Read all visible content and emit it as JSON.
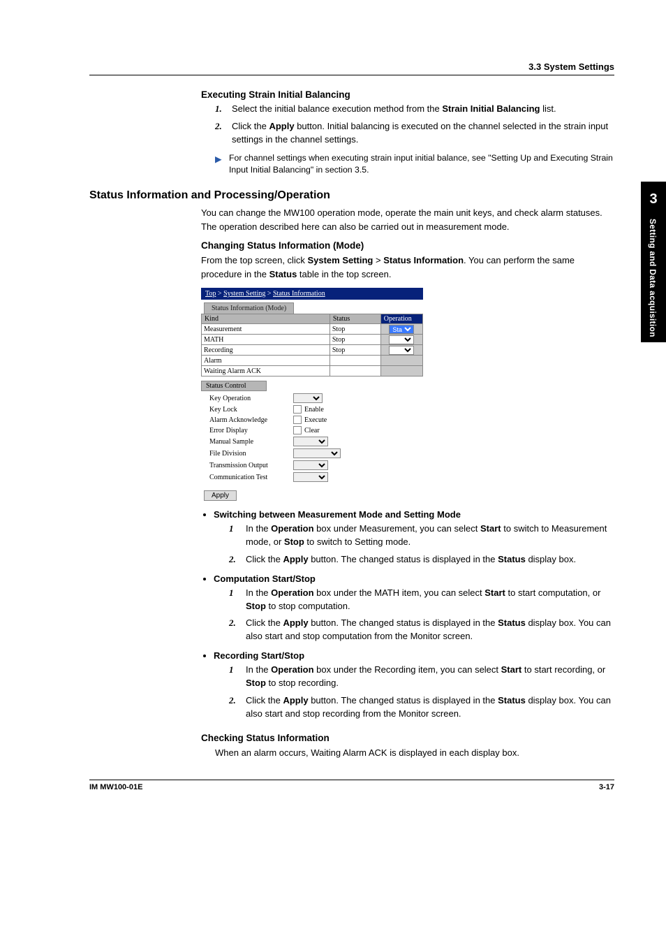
{
  "header": {
    "section": "3.3  System Settings"
  },
  "sidebar": {
    "chapter": "3",
    "title": "Setting and Data acquisition"
  },
  "strain": {
    "heading": "Executing Strain Initial Balancing",
    "steps": [
      {
        "n": "1.",
        "pre": "Select the initial balance execution method from the ",
        "bold": "Strain Initial Balancing",
        "post": " list."
      },
      {
        "n": "2.",
        "pre": "Click the ",
        "bold": "Apply",
        "post": " button. Initial balancing is executed on the channel selected in the strain input settings in the channel settings."
      }
    ],
    "note": "For channel settings when executing strain input initial balance, see \"Setting Up and Executing Strain Input Initial Balancing\" in section 3.5."
  },
  "status_section": {
    "heading": "Status Information and Processing/Operation",
    "intro": "You can change the MW100 operation mode, operate the main unit keys, and check alarm statuses. The operation described here can also be carried out in measurement mode.",
    "changing": {
      "heading": "Changing Status Information (Mode)",
      "p1a": "From the top screen, click ",
      "b1": "System Setting",
      "sep": " > ",
      "b2": "Status Information",
      "p1b": ". You can perform the same procedure in the ",
      "b3": "Status",
      "p1c": " table in the top screen."
    },
    "ui": {
      "breadcrumb": {
        "top": "Top",
        "s1": "System Setting",
        "s2": "Status Information"
      },
      "tab": "Status Information (Mode)",
      "cols": {
        "kind": "Kind",
        "status": "Status",
        "operation": "Operation"
      },
      "rows": [
        {
          "kind": "Measurement",
          "status": "Stop",
          "op": "Start"
        },
        {
          "kind": "MATH",
          "status": "Stop",
          "op": ""
        },
        {
          "kind": "Recording",
          "status": "Stop",
          "op": ""
        },
        {
          "kind": "Alarm",
          "status": "",
          "op": null
        },
        {
          "kind": "Waiting Alarm ACK",
          "status": "",
          "op": null
        }
      ],
      "control_header": "Status Control",
      "control": {
        "key_op": "Key Operation",
        "key_lock": "Key Lock",
        "key_lock_cb": "Enable",
        "alarm_ack": "Alarm Acknowledge",
        "alarm_ack_cb": "Execute",
        "err_disp": "Error Display",
        "err_disp_cb": "Clear",
        "manual": "Manual Sample",
        "file_div": "File Division",
        "trans": "Transmission Output",
        "comm": "Communication Test"
      },
      "apply": "Apply"
    },
    "bullets": {
      "b1": {
        "title": "Switching between Measurement Mode and Setting Mode",
        "s1": {
          "n": "1",
          "a": "In the ",
          "b1": "Operation",
          "b": " box under Measurement, you can select ",
          "b2": "Start",
          "c": " to switch to Measurement mode, or ",
          "b3": "Stop",
          "d": " to switch to Setting mode."
        },
        "s2": {
          "n": "2.",
          "a": "Click the ",
          "b1": "Apply",
          "b": " button. The changed status is displayed in the ",
          "b2": "Status",
          "c": " display box."
        }
      },
      "b2": {
        "title": "Computation Start/Stop",
        "s1": {
          "n": "1",
          "a": "In the ",
          "b1": "Operation",
          "b": " box under the MATH item, you can select ",
          "b2": "Start",
          "c": " to start computation, or ",
          "b3": "Stop",
          "d": " to stop computation."
        },
        "s2": {
          "n": "2.",
          "a": "Click the ",
          "b1": "Apply",
          "b": " button. The changed status is displayed in the ",
          "b2": "Status",
          "c": " display box. You can also start and stop computation from the Monitor screen."
        }
      },
      "b3": {
        "title": "Recording Start/Stop",
        "s1": {
          "n": "1",
          "a": "In the ",
          "b1": "Operation",
          "b": " box under the Recording item, you can select ",
          "b2": "Start",
          "c": " to start recording, or ",
          "b3": "Stop",
          "d": " to stop recording."
        },
        "s2": {
          "n": "2.",
          "a": "Click the ",
          "b1": "Apply",
          "b": " button. The changed status is displayed in the ",
          "b2": "Status",
          "c": " display box. You can also start and stop recording from the Monitor screen."
        }
      }
    },
    "checking": {
      "heading": "Checking Status Information",
      "p": "When an alarm occurs, Waiting Alarm ACK is displayed in each display box."
    }
  },
  "footer": {
    "left": "IM MW100-01E",
    "right": "3-17"
  }
}
